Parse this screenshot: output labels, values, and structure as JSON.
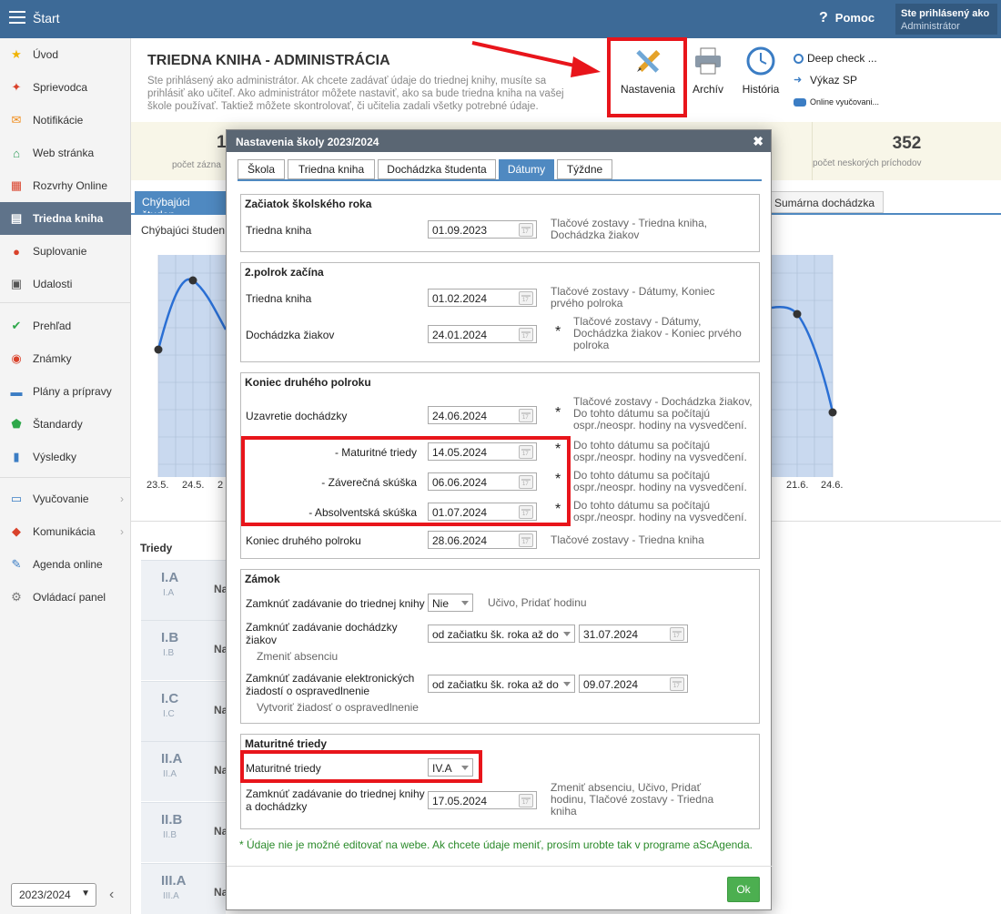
{
  "topbar": {
    "start_label": "Štart",
    "help_label": "Pomoc",
    "user_line1": "Ste prihlásený ako",
    "user_line2": "Administrátor"
  },
  "sidebar": {
    "items": [
      {
        "label": "Úvod",
        "icon": "star-icon"
      },
      {
        "label": "Sprievodca",
        "icon": "wand-icon"
      },
      {
        "label": "Notifikácie",
        "icon": "envelope-icon"
      },
      {
        "label": "Web stránka",
        "icon": "home-icon"
      },
      {
        "label": "Rozvrhy Online",
        "icon": "calendar-grid-icon"
      },
      {
        "label": "Triedna kniha",
        "icon": "book-icon"
      },
      {
        "label": "Suplovanie",
        "icon": "person-icon"
      },
      {
        "label": "Udalosti",
        "icon": "calendar-icon"
      },
      {
        "label": "Prehľad",
        "icon": "check-circle-icon"
      },
      {
        "label": "Známky",
        "icon": "grade-icon"
      },
      {
        "label": "Plány a prípravy",
        "icon": "briefcase-icon"
      },
      {
        "label": "Štandardy",
        "icon": "shield-icon"
      },
      {
        "label": "Výsledky",
        "icon": "bar-chart-icon"
      },
      {
        "label": "Vyučovanie",
        "icon": "open-book-icon"
      },
      {
        "label": "Komunikácia",
        "icon": "chat-icon"
      },
      {
        "label": "Agenda online",
        "icon": "pen-icon"
      },
      {
        "label": "Ovládací panel",
        "icon": "gear-icon"
      }
    ],
    "year": "2023/2024"
  },
  "header": {
    "title": "TRIEDNA KNIHA - ADMINISTRÁCIA",
    "description": "Ste prihlásený ako administrátor. Ak chcete zadávať údaje do triednej knihy, musíte sa prihlásiť ako učiteľ. Ako administrátor môžete nastaviť, ako sa bude triedna kniha na vašej škole používať. Taktiež môžete skontrolovať, či učitelia zadali všetky potrebné údaje.",
    "toolbar": {
      "settings": "Nastavenia",
      "archive": "Archív",
      "history": "História",
      "deep_check": "Deep check ...",
      "report": "Výkaz SP",
      "online": "Online vyučovani..."
    }
  },
  "stats": {
    "left_value": "1",
    "left_label": "počet zázna",
    "right_value": "352",
    "right_label": "počet neskorých príchodov"
  },
  "background": {
    "tab_active": "Chýbajúci študen",
    "tab_other": "Sumárna dochádzka",
    "subtitle": "Chýbajúci študen",
    "x_labels_left": [
      "23.5.",
      "24.5.",
      "2"
    ],
    "x_labels_right": [
      "21.6.",
      "24.6."
    ],
    "classes_title": "Triedy",
    "classes": [
      {
        "name": "I.A",
        "sub": "I.A",
        "col": "Na"
      },
      {
        "name": "I.B",
        "sub": "I.B",
        "col": "Na"
      },
      {
        "name": "I.C",
        "sub": "I.C",
        "col": "Na"
      },
      {
        "name": "II.A",
        "sub": "II.A",
        "col": "Na"
      },
      {
        "name": "II.B",
        "sub": "II.B",
        "col": "Na"
      },
      {
        "name": "II.C",
        "sub": "II.C",
        "col": "Na"
      },
      {
        "name": "III.A",
        "sub": "III.A",
        "col": "Na"
      }
    ]
  },
  "modal": {
    "title": "Nastavenia školy 2023/2024",
    "tabs": [
      "Škola",
      "Triedna kniha",
      "Dochádzka študenta",
      "Dátumy",
      "Týždne"
    ],
    "active_tab": "Dátumy",
    "start": {
      "title": "Začiatok školského roka",
      "label": "Triedna kniha",
      "date": "01.09.2023",
      "note": "Tlačové zostavy - Triedna kniha, Dochádzka žiakov"
    },
    "semester2": {
      "title": "2.polrok začína",
      "rows": [
        {
          "label": "Triedna kniha",
          "date": "01.02.2024",
          "star": "",
          "note": "Tlačové zostavy - Dátumy, Koniec prvého polroka"
        },
        {
          "label": "Dochádzka žiakov",
          "date": "24.01.2024",
          "star": "*",
          "note": "Tlačové zostavy - Dátumy, Dochádzka žiakov - Koniec prvého polroka"
        }
      ]
    },
    "semester_end": {
      "title": "Koniec druhého polroku",
      "rows": [
        {
          "label": "Uzavretie dochádzky",
          "date": "24.06.2024",
          "star": "*",
          "note": "Tlačové zostavy - Dochádzka žiakov, Do tohto dátumu sa počítajú ospr./neospr. hodiny na vysvedčení."
        },
        {
          "label": "- Maturitné triedy",
          "date": "14.05.2024",
          "star": "*",
          "note": "Do tohto dátumu sa počítajú ospr./neospr. hodiny na vysvedčení."
        },
        {
          "label": "- Záverečná skúška",
          "date": "06.06.2024",
          "star": "*",
          "note": "Do tohto dátumu sa počítajú ospr./neospr. hodiny na vysvedčení."
        },
        {
          "label": "- Absolventská skúška",
          "date": "01.07.2024",
          "star": "*",
          "note": "Do tohto dátumu sa počítajú ospr./neospr. hodiny na vysvedčení."
        },
        {
          "label": "Koniec druhého polroku",
          "date": "28.06.2024",
          "star": "",
          "note": "Tlačové zostavy - Triedna kniha"
        }
      ]
    },
    "lock": {
      "title": "Zámok",
      "row1_label": "Zamknúť zadávanie do triednej knihy",
      "row1_value": "Nie",
      "row1_note": "Učivo, Pridať hodinu",
      "row2_label": "Zamknúť zadávanie dochádzky žiakov",
      "row2_select": "od začiatku šk. roka až do",
      "row2_date": "31.07.2024",
      "row2_sub": "Zmeniť absenciu",
      "row3_label": "Zamknúť zadávanie elektronických žiadostí o ospravedlnenie",
      "row3_select": "od začiatku šk. roka až do",
      "row3_date": "09.07.2024",
      "row3_sub": "Vytvoriť žiadosť o ospravedlnenie"
    },
    "graduation": {
      "title": "Maturitné triedy",
      "row1_label": "Maturitné triedy",
      "row1_value": "IV.A",
      "row2_label": "Zamknúť zadávanie do triednej knihy a dochádzky",
      "row2_date": "17.05.2024",
      "row2_note": "Zmeniť absenciu, Učivo, Pridať hodinu, Tlačové zostavy - Triedna kniha"
    },
    "footer_note": "* Údaje nie je možné editovať na webe. Ak chcete údaje meniť, prosím urobte tak v programe aScAgenda.",
    "ok_label": "Ok"
  },
  "colors": {
    "topbar": "#3d6a97",
    "accent": "#4f89c1",
    "highlight": "#e8151b",
    "ok": "#4caf50"
  }
}
